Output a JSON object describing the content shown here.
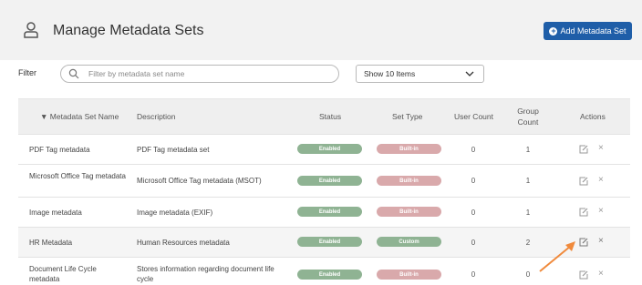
{
  "header": {
    "title": "Manage Metadata Sets",
    "add_button_label": "Add Metadata Set",
    "accent_color": "#1f5ea8"
  },
  "filter": {
    "label": "Filter",
    "search_placeholder": "Filter by metadata set name",
    "page_size_selected": "Show 10 Items"
  },
  "table": {
    "columns": {
      "name": "▼ Metadata Set Name",
      "description": "Description",
      "status": "Status",
      "set_type": "Set Type",
      "user_count": "User Count",
      "group_count_line1": "Group",
      "group_count_line2": "Count",
      "actions": "Actions"
    },
    "rows": [
      {
        "name": "PDF Tag metadata",
        "description": "PDF Tag metadata set",
        "status": "Enabled",
        "set_type": "Built-in",
        "user_count": "0",
        "group_count": "1"
      },
      {
        "name": "Microsoft Office Tag metadata",
        "description": "Microsoft Office Tag metadata (MSOT)",
        "status": "Enabled",
        "set_type": "Built-in",
        "user_count": "0",
        "group_count": "1"
      },
      {
        "name": "Image metadata",
        "description": "Image metadata (EXIF)",
        "status": "Enabled",
        "set_type": "Built-in",
        "user_count": "0",
        "group_count": "1"
      },
      {
        "name": "HR Metadata",
        "description": "Human Resources metadata",
        "status": "Enabled",
        "set_type": "Custom",
        "user_count": "0",
        "group_count": "2"
      },
      {
        "name": "Document Life Cycle metadata",
        "description": "Stores information regarding document life cycle",
        "status": "Enabled",
        "set_type": "Built-in",
        "user_count": "0",
        "group_count": "0"
      }
    ]
  },
  "colors": {
    "enabled": "#8fb393",
    "builtin": "#d9a9ab",
    "custom": "#8fb393",
    "annotation_arrow": "#f08a3c"
  },
  "icons": {
    "title_icon": "user-icon",
    "search": "search-icon",
    "dropdown": "chevron-down-icon",
    "edit": "edit-icon",
    "delete": "close-icon"
  }
}
